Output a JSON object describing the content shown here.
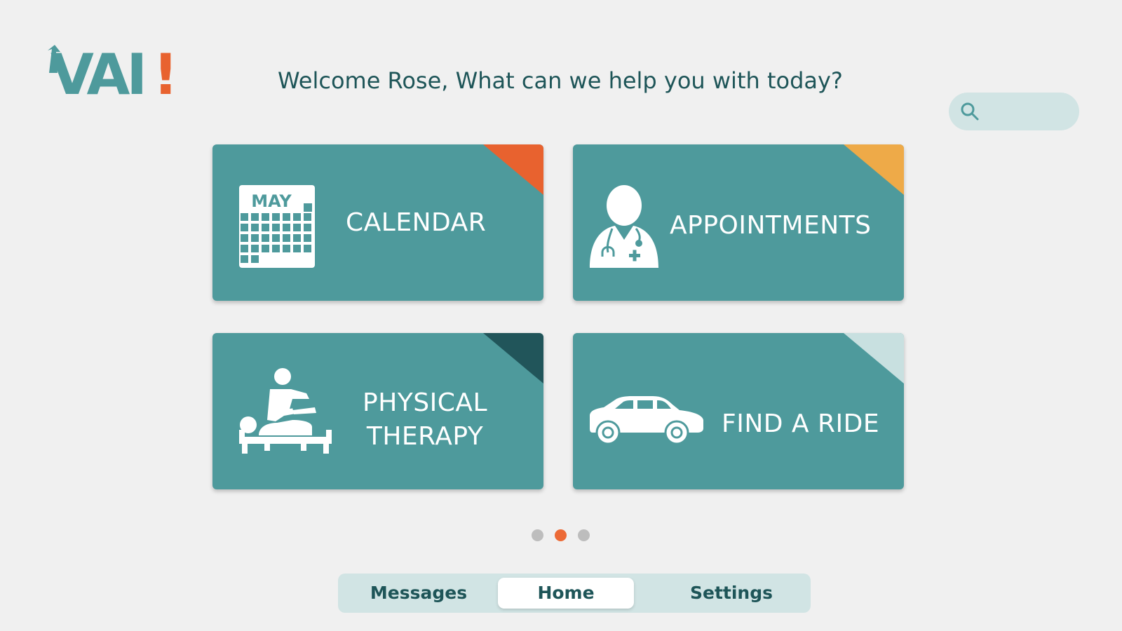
{
  "app": {
    "logo_text": "VAI",
    "logo_accent": "!",
    "brand_color": "#4e9a9c",
    "accent_color": "#e8622f"
  },
  "header": {
    "welcome": "Welcome Rose, What can we help you with today?"
  },
  "search": {
    "placeholder": "",
    "icon": "search-icon"
  },
  "tiles": [
    {
      "label": "CALENDAR",
      "icon": "calendar-icon",
      "icon_text": "MAY",
      "corner_color": "#e8622f"
    },
    {
      "label": "APPOINTMENTS",
      "icon": "doctor-icon",
      "corner_color": "#eeaa48"
    },
    {
      "label_line1": "PHYSICAL",
      "label_line2": "THERAPY",
      "icon": "physical-therapy-icon",
      "corner_color": "#21555a"
    },
    {
      "label": "FIND A RIDE",
      "icon": "car-icon",
      "corner_color": "#c8e0e0"
    }
  ],
  "pagination": {
    "total": 3,
    "active_index": 1
  },
  "nav": {
    "messages": "Messages",
    "home": "Home",
    "settings": "Settings",
    "active": "Home"
  }
}
